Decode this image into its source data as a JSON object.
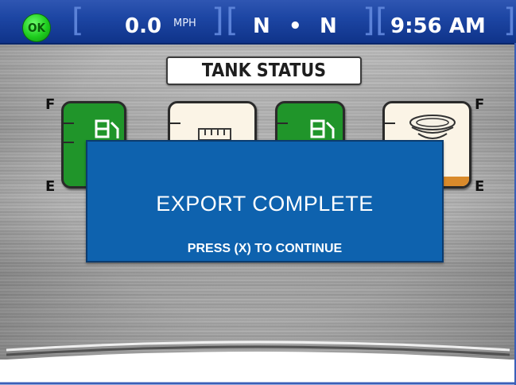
{
  "status_bar": {
    "ok_indicator": "OK",
    "speed_value": "0.0",
    "speed_unit": "MPH",
    "gear_left": "N",
    "gear_separator": "•",
    "gear_right": "N",
    "clock": "9:56 AM"
  },
  "page": {
    "title": "TANK STATUS"
  },
  "tank_scale": {
    "full_label": "F",
    "empty_label": "E"
  },
  "tanks": [
    {
      "name": "tank-1",
      "style": "green",
      "icon": "fuel-nozzle-icon"
    },
    {
      "name": "tank-2",
      "style": "cream",
      "icon": "tank-grid-icon"
    },
    {
      "name": "tank-3",
      "style": "green",
      "icon": "fuel-nozzle-icon"
    },
    {
      "name": "tank-4",
      "style": "cream",
      "icon": "bowl-icon",
      "level_fraction": 0.12
    }
  ],
  "dialog": {
    "title": "EXPORT COMPLETE",
    "subtitle": "PRESS (X) TO CONTINUE"
  },
  "colors": {
    "status_bar": "#1d46a4",
    "ok_green": "#1ecc1e",
    "tank_green": "#20952a",
    "tank_cream": "#fbf4e6",
    "level_orange": "#d98a2b",
    "dialog_blue": "#0e62ae"
  }
}
